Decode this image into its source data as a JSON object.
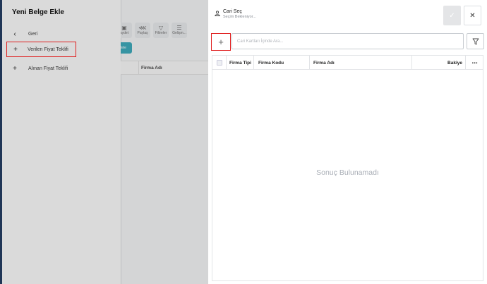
{
  "background": {
    "toolbar": [
      {
        "icon": "save-icon",
        "label": "aydet"
      },
      {
        "icon": "share-icon",
        "label": "Paylaş"
      },
      {
        "icon": "filter-icon",
        "label": "Filtreler"
      },
      {
        "icon": "sliders-icon",
        "label": "Gelişm..."
      }
    ],
    "teal_button": "ntele",
    "table_header": "Firma Adı"
  },
  "drawer": {
    "title": "Yeni Belge Ekle",
    "items": [
      {
        "icon": "chevron-left-icon",
        "label": "Geri"
      },
      {
        "icon": "plus-icon",
        "label": "Verilen Fiyat Teklifi"
      },
      {
        "icon": "plus-icon",
        "label": "Alınan Fiyat Teklifi"
      }
    ]
  },
  "panel": {
    "title": "Cari Seç",
    "subtitle": "Seçim Bekleniyor...",
    "search_placeholder": "Cari Kartları İçinde Ara...",
    "columns": [
      "Firma Tipi",
      "Firma Kodu",
      "Firma Adı",
      "Bakiye"
    ],
    "more": "⋯",
    "empty_text": "Sonuç Bulunamadı"
  },
  "colors": {
    "accent_red": "#e02020",
    "teal": "#1a9bb0",
    "drawer_border": "#1f3556"
  }
}
